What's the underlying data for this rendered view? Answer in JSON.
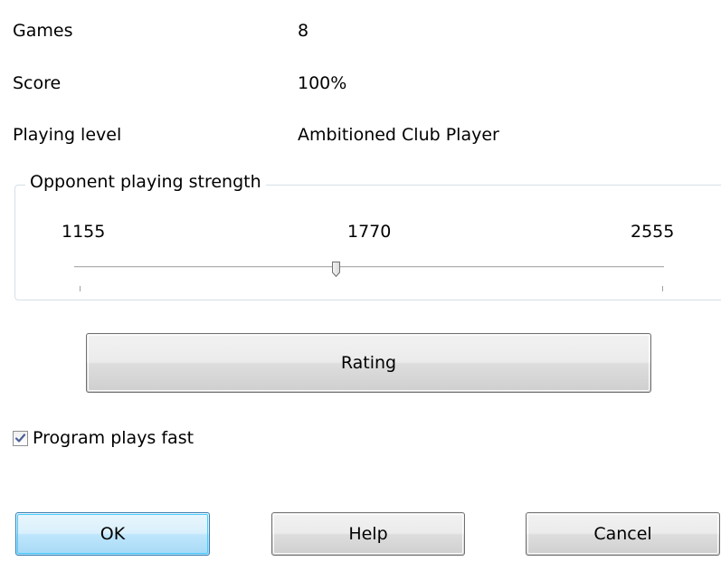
{
  "info": {
    "games": {
      "label": "Games",
      "value": "8"
    },
    "score": {
      "label": "Score",
      "value": "100%"
    },
    "playing_level": {
      "label": "Playing level",
      "value": "Ambitioned Club Player"
    }
  },
  "strength": {
    "legend": "Opponent playing strength",
    "min_label": "1155",
    "current_label": "1770",
    "max_label": "2555",
    "min": 1155,
    "max": 2555,
    "value": 1770
  },
  "rating_button": "Rating",
  "fast_checkbox": {
    "label": "Program plays fast",
    "checked": true
  },
  "buttons": {
    "ok": "OK",
    "help": "Help",
    "cancel": "Cancel"
  },
  "colors": {
    "default_button_border": "#3c7fb1",
    "checkmark": "#4a5f97",
    "groupbox_border": "#d5dfe5"
  }
}
